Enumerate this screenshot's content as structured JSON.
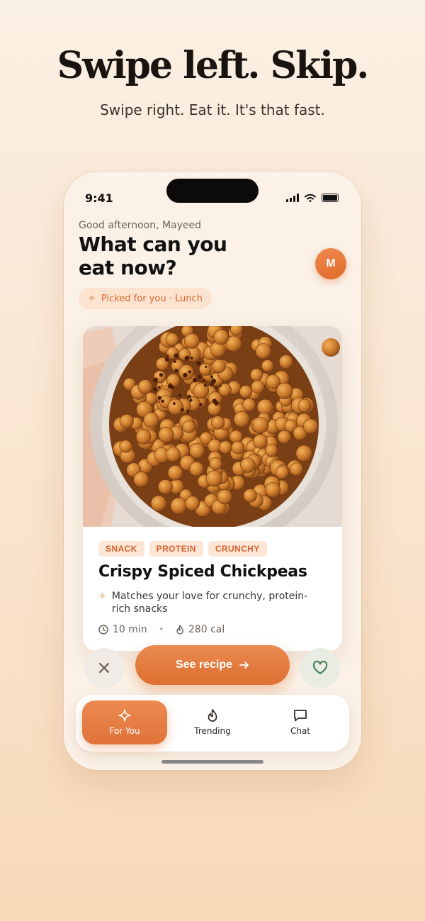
{
  "hero": {
    "headline": "Swipe left. Skip.",
    "subline": "Swipe right. Eat it. It's that fast."
  },
  "status_bar": {
    "time": "9:41"
  },
  "header": {
    "greeting": "Good afternoon, Mayeed",
    "title": "What can you eat now?",
    "avatar_initial": "M",
    "context_pill": "Picked for you · Lunch"
  },
  "card": {
    "tags": [
      "SNACK",
      "PROTEIN",
      "CRUNCHY"
    ],
    "title": "Crispy Spiced Chickpeas",
    "match_reason": "Matches your love for crunchy, protein-rich snacks",
    "time": "10 min",
    "calories": "280 cal"
  },
  "actions": {
    "see_recipe": "See recipe",
    "skip_icon": "close-icon",
    "like_icon": "heart-icon"
  },
  "tabs": [
    {
      "label": "For You",
      "icon": "sparkle-icon",
      "active": true
    },
    {
      "label": "Trending",
      "icon": "flame-icon",
      "active": false
    },
    {
      "label": "Chat",
      "icon": "chat-icon",
      "active": false
    }
  ],
  "colors": {
    "accent": "#E07335",
    "accent_light": "#FBE3D0",
    "background": "#FBF0E4",
    "like_green": "#3F7A55"
  }
}
